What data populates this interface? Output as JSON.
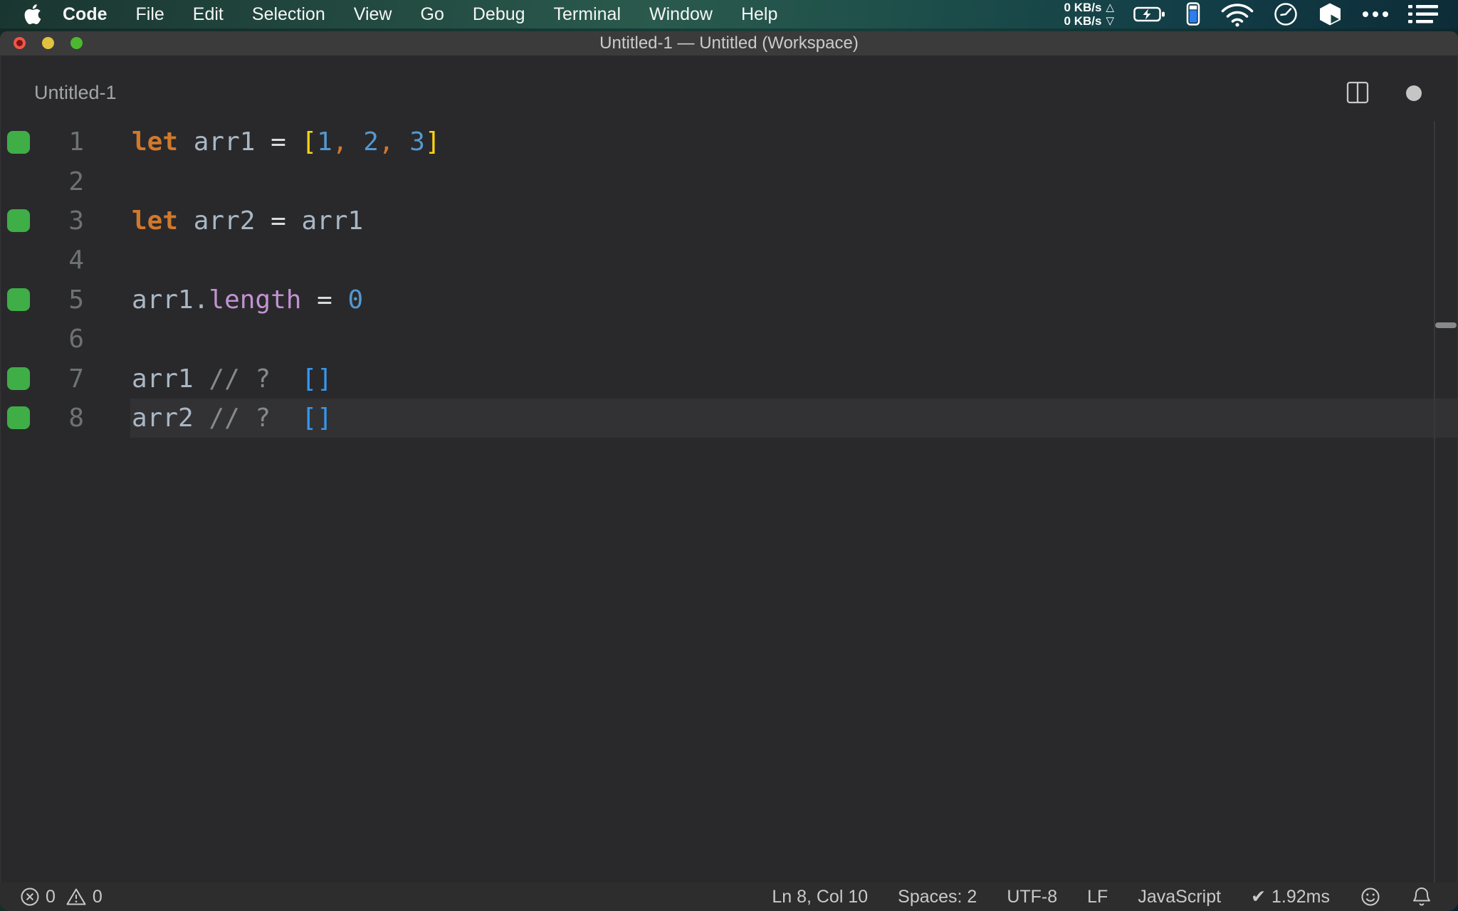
{
  "menubar": {
    "apple_icon": "apple-logo",
    "active_app": "Code",
    "items": [
      "Code",
      "File",
      "Edit",
      "Selection",
      "View",
      "Go",
      "Debug",
      "Terminal",
      "Window",
      "Help"
    ],
    "status": {
      "net_up_label": "0 KB/s",
      "net_up_arrow": "△",
      "net_down_label": "0 KB/s",
      "net_down_arrow": "▽",
      "icons": [
        "battery-charging-icon",
        "battery-vertical-icon",
        "wifi-icon",
        "clock-icon",
        "box-app-icon",
        "ellipsis-icon",
        "list-menu-icon"
      ]
    }
  },
  "titlebar": {
    "title": "Untitled-1 — Untitled (Workspace)"
  },
  "tabbar": {
    "tab_label": "Untitled-1",
    "icons": [
      "split-editor-icon",
      "unsaved-dot"
    ]
  },
  "editor": {
    "marker_color": "#3fae47",
    "background": "#29292b",
    "current_line_background": "#323234",
    "token_colors": {
      "keyword": "#d0792d",
      "var": "#a9b7c5",
      "op": "#d8dbdf",
      "bracket": "#ffd312",
      "num": "#5598cf",
      "comma": "#d0792d",
      "punct": "#a9b7c5",
      "prop": "#c292d2",
      "comment": "#84898e",
      "quokka_value": "#3598ef",
      "plain": "#a9b7c5"
    },
    "lines": [
      {
        "num": 1,
        "marker": true,
        "current": false,
        "tokens": [
          [
            "let",
            "keyword"
          ],
          [
            " ",
            "plain"
          ],
          [
            "arr1",
            "var"
          ],
          [
            " ",
            "plain"
          ],
          [
            "=",
            "op"
          ],
          [
            " ",
            "plain"
          ],
          [
            "[",
            "bracket"
          ],
          [
            "1",
            "num"
          ],
          [
            ",",
            "comma"
          ],
          [
            " ",
            "plain"
          ],
          [
            "2",
            "num"
          ],
          [
            ",",
            "comma"
          ],
          [
            " ",
            "plain"
          ],
          [
            "3",
            "num"
          ],
          [
            "]",
            "bracket"
          ]
        ]
      },
      {
        "num": 2,
        "marker": false,
        "current": false,
        "tokens": []
      },
      {
        "num": 3,
        "marker": true,
        "current": false,
        "tokens": [
          [
            "let",
            "keyword"
          ],
          [
            " ",
            "plain"
          ],
          [
            "arr2",
            "var"
          ],
          [
            " ",
            "plain"
          ],
          [
            "=",
            "op"
          ],
          [
            " ",
            "plain"
          ],
          [
            "arr1",
            "var"
          ]
        ]
      },
      {
        "num": 4,
        "marker": false,
        "current": false,
        "tokens": []
      },
      {
        "num": 5,
        "marker": true,
        "current": false,
        "tokens": [
          [
            "arr1",
            "var"
          ],
          [
            ".",
            "punct"
          ],
          [
            "length",
            "prop"
          ],
          [
            " ",
            "plain"
          ],
          [
            "=",
            "op"
          ],
          [
            " ",
            "plain"
          ],
          [
            "0",
            "num"
          ]
        ]
      },
      {
        "num": 6,
        "marker": false,
        "current": false,
        "tokens": []
      },
      {
        "num": 7,
        "marker": true,
        "current": false,
        "tokens": [
          [
            "arr1",
            "var"
          ],
          [
            " ",
            "plain"
          ],
          [
            "// ?",
            "comment"
          ],
          [
            "  ",
            "plain"
          ],
          [
            "[]",
            "quokka_value"
          ]
        ]
      },
      {
        "num": 8,
        "marker": true,
        "current": true,
        "tokens": [
          [
            "arr2",
            "var"
          ],
          [
            " ",
            "plain"
          ],
          [
            "// ?",
            "comment"
          ],
          [
            "  ",
            "plain"
          ],
          [
            "[]",
            "quokka_value"
          ]
        ]
      }
    ]
  },
  "statusbar": {
    "errors": "0",
    "warnings": "0",
    "cursor_position": "Ln 8, Col 10",
    "indentation": "Spaces: 2",
    "encoding": "UTF-8",
    "eol": "LF",
    "language": "JavaScript",
    "perf_check": "✔",
    "perf_time": "1.92ms",
    "icons": [
      "error-icon",
      "warning-icon",
      "smiley-icon",
      "bell-icon"
    ]
  }
}
